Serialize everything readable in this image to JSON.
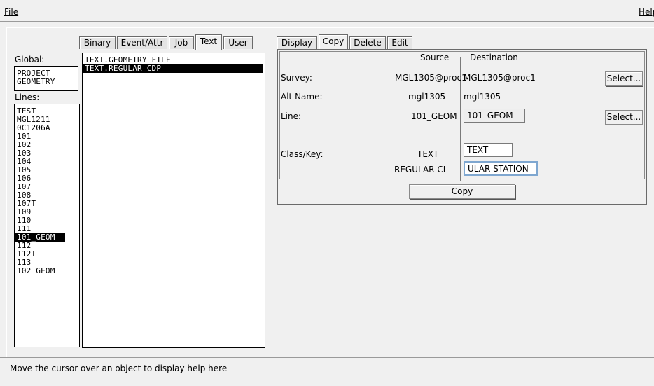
{
  "menubar": {
    "file": "File",
    "help": "Help"
  },
  "left": {
    "global_label": "Global:",
    "global_items": [
      "PROJECT",
      "GEOMETRY"
    ],
    "lines_label": "Lines:",
    "lines_items": [
      "TEST",
      "MGL1211",
      "0C1206A",
      "101",
      "102",
      "103",
      "104",
      "105",
      "106",
      "107",
      "108",
      "107T",
      "109",
      "110",
      "111",
      "101_GEOM",
      "112",
      "112T",
      "113",
      "102_GEOM"
    ],
    "lines_selected": "101_GEOM"
  },
  "middle": {
    "tabs": [
      "Binary",
      "Event/Attr",
      "Job",
      "Text",
      "User"
    ],
    "active_tab": "Text",
    "items": [
      "TEXT.GEOMETRY FILE",
      "TEXT.REGULAR CDP"
    ],
    "selected_item": "TEXT.REGULAR CDP"
  },
  "right": {
    "tabs": [
      "Display",
      "Copy",
      "Delete",
      "Edit"
    ],
    "active_tab": "Copy",
    "source_title": "Source",
    "destination_title": "Destination",
    "survey_label": "Survey:",
    "altname_label": "Alt Name:",
    "line_label": "Line:",
    "classkey_label": "Class/Key:",
    "source_survey": "MGL1305@proc1",
    "source_altname": "mgl1305",
    "source_line": "101_GEOM",
    "source_class": "TEXT",
    "source_key": "REGULAR CI",
    "dest_survey": "MGL1305@proc1",
    "dest_altname": "mgl1305",
    "dest_line": "101_GEOM",
    "dest_class": "TEXT",
    "dest_key": "ULAR STATION",
    "select_label": "Select...",
    "copy_label": "Copy"
  },
  "help_text": "Move the cursor over an object to display help here"
}
